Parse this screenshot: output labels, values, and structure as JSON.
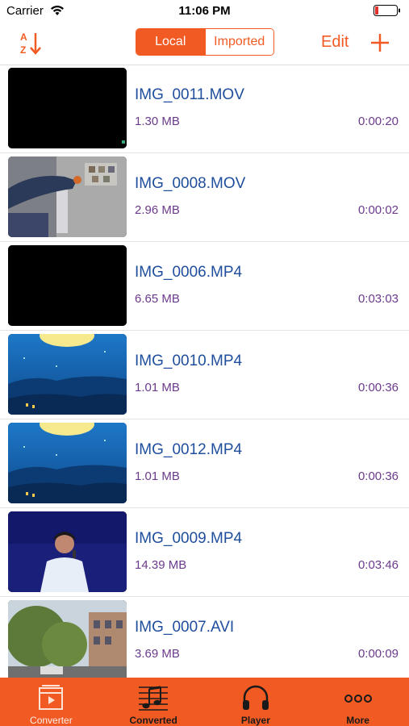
{
  "status_bar": {
    "carrier": "Carrier",
    "time": "11:06 PM"
  },
  "nav": {
    "sort_icon": "sort-az-icon",
    "segments": [
      {
        "label": "Local",
        "selected": true
      },
      {
        "label": "Imported",
        "selected": false
      }
    ],
    "edit_label": "Edit",
    "add_icon": "plus-icon",
    "accent_color": "#f15a22"
  },
  "files": [
    {
      "name": "IMG_0011.MOV",
      "size": "1.30 MB",
      "duration": "0:00:20",
      "thumb": "black"
    },
    {
      "name": "IMG_0008.MOV",
      "size": "2.96 MB",
      "duration": "0:00:02",
      "thumb": "room"
    },
    {
      "name": "IMG_0006.MP4",
      "size": "6.65 MB",
      "duration": "0:03:03",
      "thumb": "black"
    },
    {
      "name": "IMG_0010.MP4",
      "size": "1.01 MB",
      "duration": "0:00:36",
      "thumb": "moon"
    },
    {
      "name": "IMG_0012.MP4",
      "size": "1.01 MB",
      "duration": "0:00:36",
      "thumb": "moon"
    },
    {
      "name": "IMG_0009.MP4",
      "size": "14.39 MB",
      "duration": "0:03:46",
      "thumb": "stage"
    },
    {
      "name": "IMG_0007.AVI",
      "size": "3.69 MB",
      "duration": "0:00:09",
      "thumb": "street"
    }
  ],
  "tabs": [
    {
      "label": "Converter",
      "icon": "video-file-icon",
      "active": true
    },
    {
      "label": "Converted",
      "icon": "music-notes-icon",
      "active": false
    },
    {
      "label": "Player",
      "icon": "headphones-icon",
      "active": false
    },
    {
      "label": "More",
      "icon": "more-dots-icon",
      "active": false
    }
  ]
}
